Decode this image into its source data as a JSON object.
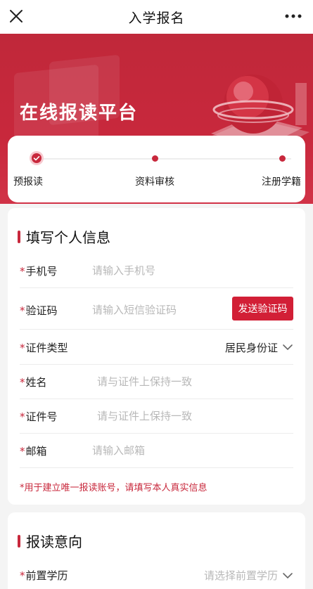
{
  "header": {
    "title": "入学报名"
  },
  "banner": {
    "title": "在线报读平台"
  },
  "steps": [
    {
      "label": "预报读"
    },
    {
      "label": "资料审核"
    },
    {
      "label": "注册学籍"
    }
  ],
  "personal": {
    "title": "填写个人信息",
    "phone": {
      "label": "手机号",
      "placeholder": "请输入手机号"
    },
    "code": {
      "label": "验证码",
      "placeholder": "请输入短信验证码",
      "button": "发送验证码"
    },
    "idtype": {
      "label": "证件类型",
      "value": "居民身份证"
    },
    "name": {
      "label": "姓名",
      "placeholder": "请与证件上保持一致"
    },
    "idno": {
      "label": "证件号",
      "placeholder": "请与证件上保持一致"
    },
    "email": {
      "label": "邮箱",
      "placeholder": "请输入邮箱"
    },
    "notice": "*用于建立唯一报读账号，请填写本人真实信息"
  },
  "intent": {
    "title": "报读意向",
    "education": {
      "label": "前置学历",
      "placeholder": "请选择前置学历"
    }
  },
  "required_mark": "*",
  "colors": {
    "accent": "#c8283c",
    "button": "#d21f36"
  }
}
